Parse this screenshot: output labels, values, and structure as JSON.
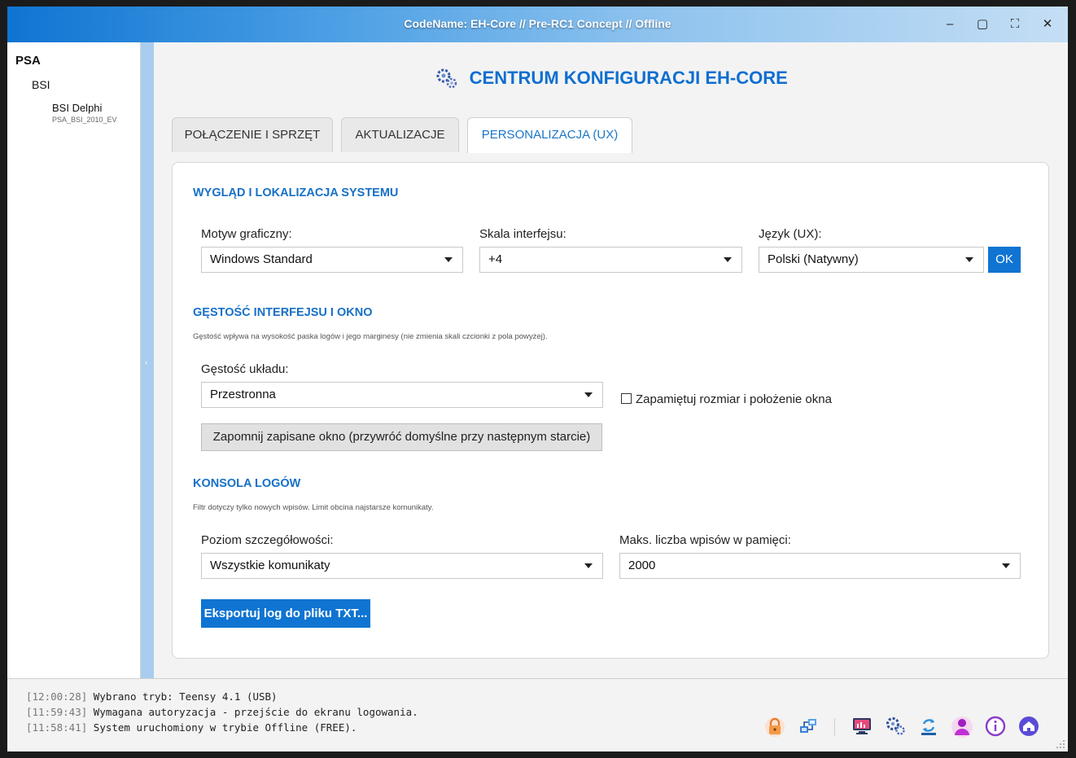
{
  "window": {
    "title": "CodeName: EH-Core // Pre-RC1 Concept // Offline",
    "controls": {
      "minimize": "–",
      "maximize": "▢",
      "fullscreen": "⛶",
      "close": "✕"
    }
  },
  "sidebar": {
    "root": "PSA",
    "group": "BSI",
    "item": {
      "label": "BSI Delphi",
      "sub": "PSA_BSI_2010_EV"
    },
    "collapse_glyph": "‹"
  },
  "header": {
    "title": "CENTRUM KONFIGURACJI EH-CORE",
    "icon": "gears-icon"
  },
  "tabs": [
    {
      "label": "POŁĄCZENIE I SPRZĘT",
      "active": false
    },
    {
      "label": "AKTUALIZACJE",
      "active": false
    },
    {
      "label": "PERSONALIZACJA (UX)",
      "active": true
    }
  ],
  "sections": {
    "appearance": {
      "title": "WYGLĄD I LOKALIZACJA SYSTEMU",
      "theme": {
        "label": "Motyw graficzny:",
        "value": "Windows Standard"
      },
      "scale": {
        "label": "Skala interfejsu:",
        "value": "+4"
      },
      "language": {
        "label": "Język (UX):",
        "value": "Polski (Natywny)",
        "ok_label": "OK"
      }
    },
    "density": {
      "title": "GĘSTOŚĆ INTERFEJSU I OKNO",
      "note": "Gęstość wpływa na wysokość paska logów i jego marginesy (nie zmienia skali czcionki z pola powyżej).",
      "layout": {
        "label": "Gęstość układu:",
        "value": "Przestronna"
      },
      "remember": {
        "label": "Zapamiętuj rozmiar i położenie okna",
        "checked": false
      },
      "forget_button": "Zapomnij zapisane okno (przywróć domyślne przy następnym starcie)"
    },
    "logs": {
      "title": "KONSOLA LOGÓW",
      "note": "Filtr dotyczy tylko nowych wpisów. Limit obcina najstarsze komunikaty.",
      "level": {
        "label": "Poziom szczegółowości:",
        "value": "Wszystkie komunikaty"
      },
      "max": {
        "label": "Maks. liczba wpisów w pamięci:",
        "value": "2000"
      },
      "export_button": "Eksportuj log do pliku TXT..."
    }
  },
  "log": [
    {
      "time": "[12:00:28]",
      "text": "Wybrano tryb: Teensy 4.1 (USB)"
    },
    {
      "time": "[11:59:43]",
      "text": "Wymagana autoryzacja - przejście do ekranu logowania."
    },
    {
      "time": "[11:58:41]",
      "text": "System uruchomiony w trybie Offline (FREE)."
    }
  ],
  "tray": [
    "lock-icon",
    "network-icon",
    "monitor-chart-icon",
    "gears-icon",
    "sync-icon",
    "user-icon",
    "info-icon",
    "home-icon"
  ],
  "colors": {
    "accent": "#0f74d2",
    "section_title": "#1670c7",
    "splitter": "#a9cdee"
  }
}
